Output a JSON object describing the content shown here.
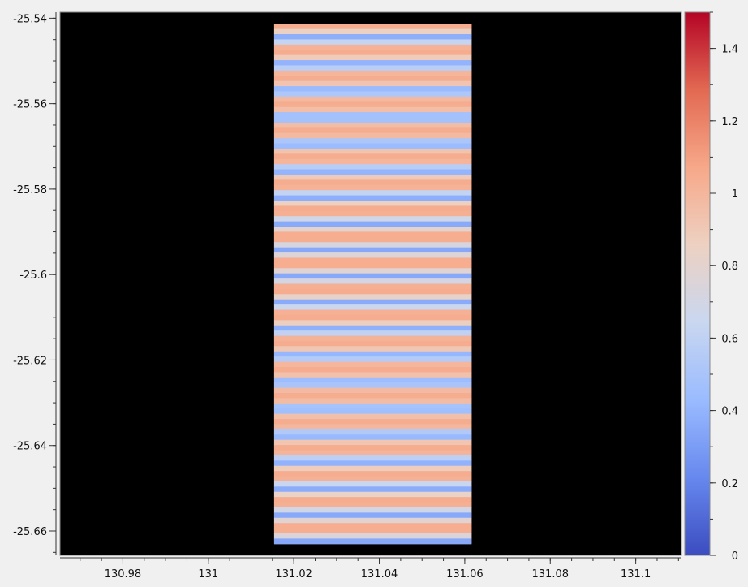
{
  "chart_data": {
    "type": "heatmap",
    "title": "",
    "xlabel": "",
    "ylabel": "",
    "xlim": [
      130.9653,
      131.1107
    ],
    "ylim": [
      -25.6657,
      -25.5386
    ],
    "x_ticks": [
      {
        "value": 130.98,
        "label": "130.98"
      },
      {
        "value": 131.0,
        "label": "131"
      },
      {
        "value": 131.02,
        "label": "131.02"
      },
      {
        "value": 131.04,
        "label": "131.04"
      },
      {
        "value": 131.06,
        "label": "131.06"
      },
      {
        "value": 131.08,
        "label": "131.08"
      },
      {
        "value": 131.1,
        "label": "131.1"
      }
    ],
    "y_ticks": [
      {
        "value": -25.54,
        "label": "-25.54"
      },
      {
        "value": -25.56,
        "label": "-25.56"
      },
      {
        "value": -25.58,
        "label": "-25.58"
      },
      {
        "value": -25.6,
        "label": "-25.6"
      },
      {
        "value": -25.62,
        "label": "-25.62"
      },
      {
        "value": -25.64,
        "label": "-25.64"
      },
      {
        "value": -25.66,
        "label": "-25.66"
      }
    ],
    "background": "#000000",
    "data_region": {
      "x": [
        131.0154,
        131.0616
      ],
      "y": [
        -25.5413,
        -25.663
      ]
    },
    "stripe_pattern": {
      "orientation": "horizontal",
      "period_deg": 0.0062,
      "phase_deg": -25.5446,
      "value_high": 1.05,
      "value_low": 0.35
    },
    "colorbar": {
      "colormap": "coolwarm",
      "range": [
        0,
        1.5
      ],
      "ticks": [
        {
          "value": 0,
          "label": "0"
        },
        {
          "value": 0.2,
          "label": "0.2"
        },
        {
          "value": 0.4,
          "label": "0.4"
        },
        {
          "value": 0.6,
          "label": "0.6"
        },
        {
          "value": 0.8,
          "label": "0.8"
        },
        {
          "value": 1.0,
          "label": "1"
        },
        {
          "value": 1.2,
          "label": "1.2"
        },
        {
          "value": 1.4,
          "label": "1.4"
        }
      ],
      "colors": [
        "#3b4cc0",
        "#6788ee",
        "#9abbff",
        "#c9d7f0",
        "#edd1c2",
        "#f7a889",
        "#e26952",
        "#b40426"
      ]
    }
  }
}
